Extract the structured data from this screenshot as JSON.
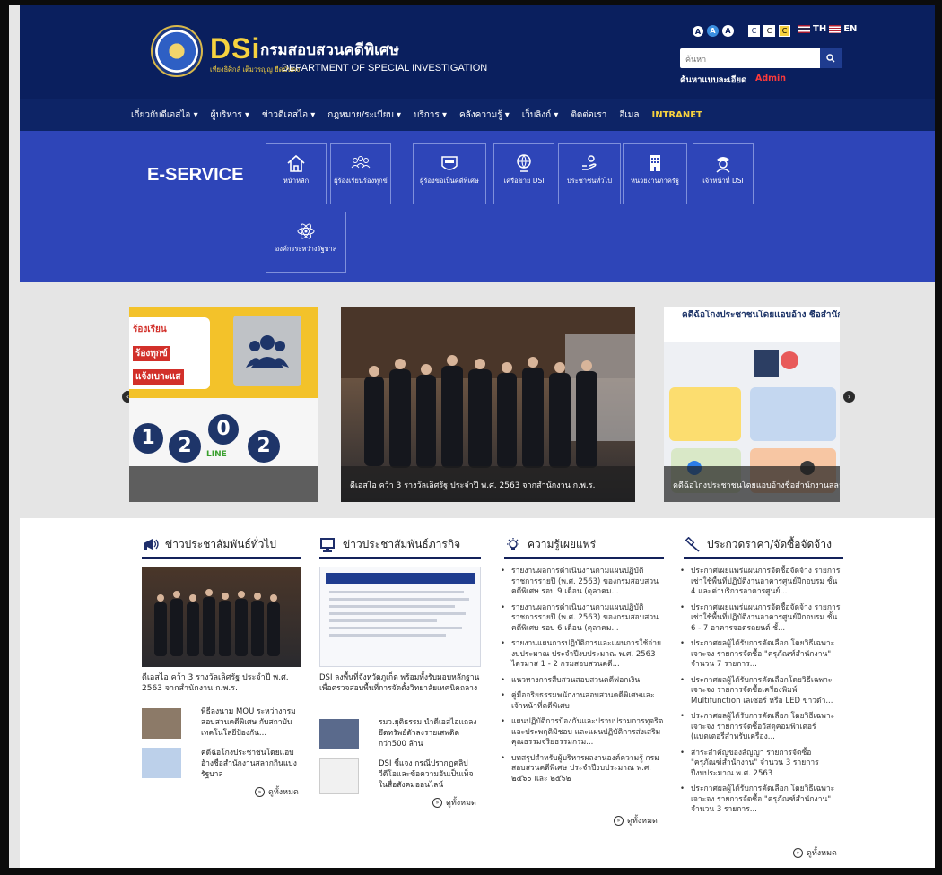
{
  "header": {
    "logo_dsi": "DSi",
    "logo_th": "กรมสอบสวนคดีพิเศษ",
    "logo_sub_th": "เที่ยงธิศิกล์ เต็มวรญญ ยืดมั่นคง",
    "logo_sub_en": "DEPARTMENT OF SPECIAL INVESTIGATION",
    "font_sizes": [
      "A",
      "A",
      "A"
    ],
    "contrast": [
      "C",
      "C",
      "C"
    ],
    "lang_th": "TH",
    "lang_en": "EN",
    "search_placeholder": "ค้นหา",
    "advanced_search": "ค้นหาแบบละเอียด",
    "admin": "Admin"
  },
  "nav": {
    "items": [
      "เกี่ยวกับดีเอสไอ",
      "ผู้บริหาร",
      "ข่าวดีเอสไอ",
      "กฎหมาย/ระเบียบ",
      "บริการ",
      "คลังความรู้",
      "เว็บลิงก์",
      "ติดต่อเรา",
      "อีเมล",
      "INTRANET"
    ]
  },
  "eservice": {
    "title": "E-SERVICE",
    "tiles": [
      "หน้าหลัก",
      "ผู้ร้องเรียนร้องทุกข์",
      "ผู้ร้องขอเป็นคดีพิเศษ",
      "เครือข่าย DSI",
      "ประชาชนทั่วไป",
      "หน่วยงานภาครัฐ",
      "เจ้าหน้าที่ DSI",
      "องค์กรระหว่างรัฐบาล"
    ]
  },
  "slider": {
    "slide1_lines": [
      "ร้องเรียน",
      "ร้องทุกข์",
      "แจ้งเบาะแส"
    ],
    "slide1_number": [
      "1",
      "2",
      "0",
      "2"
    ],
    "slide1_line_tag": "LINE",
    "caption2": "ดีเอสไอ คว้า 3 รางวัลเลิศรัฐ ประจำปี พ.ศ. 2563 จากสำนักงาน ก.พ.ร.",
    "slide3_title": "คดีฉ้อโกงประชาชนโดยแอบอ้าง ชื่อสำนักงานสลากกินแบ่ง",
    "caption3": "คดีฉ้อโกงประชาชนโดยแอบอ้างชื่อสำนักงานสลากกินแบ่งรัฐบาล"
  },
  "news": {
    "col1": {
      "title": "ข่าวประชาสัมพันธ์ทั่วไป",
      "main_caption": "ดีเอสไอ คว้า 3 รางวัลเลิศรัฐ ประจำปี พ.ศ. 2563 จากสำนักงาน ก.พ.ร.",
      "items": [
        "พิธีลงนาม MOU ระหว่างกรมสอบสวนคดีพิเศษ กับสถาบันเทคโนโลยีป้องกัน...",
        "คดีฉ้อโกงประชาชนโดยแอบอ้างชื่อสำนักงานสลากกินแบ่งรัฐบาล"
      ],
      "more": "ดูทั้งหมด"
    },
    "col2": {
      "title": "ข่าวประชาสัมพันธ์ภารกิจ",
      "main_caption": "DSI ลงพื้นที่จังหวัดภูเก็ต พร้อมทั้งรับมอบหลักฐาน เพื่อตรวจสอบพื้นที่การจัดตั้งวิทยาลัยเทคนิคถลาง",
      "items": [
        "รมว.ยุติธรรม นำดีเอสไอแถลงยึดทรัพย์ตัวลงรายเสพติด กว่า500 ล้าน",
        "DSI ชี้แจง กรณีปรากฏคลิปวีดีโอและข้อความอันเป็นเท็จในสื่อสังคมออนไลน์"
      ],
      "more": "ดูทั้งหมด"
    },
    "col3": {
      "title": "ความรู้เผยแพร่",
      "items": [
        "รายงานผลการดำเนินงานตามแผนปฏิบัติราชการรายปี (พ.ศ. 2563) ของกรมสอบสวนคดีพิเศษ รอบ 9 เดือน (ตุลาคม...",
        "รายงานผลการดำเนินงานตามแผนปฏิบัติราชการรายปี (พ.ศ. 2563) ของกรมสอบสวนคดีพิเศษ รอบ 6 เดือน (ตุลาคม...",
        "รายงานแผนการปฏิบัติการและแผนการใช้จ่ายงบประมาณ ประจำปีงบประมาณ พ.ศ. 2563 ไตรมาส 1 - 2 กรมสอบสวนคดี...",
        "แนวทางการสืบสวนสอบสวนคดีฟอกเงิน",
        "คู่มือจริยธรรมพนักงานสอบสวนคดีพิเศษและเจ้าหน้าที่คดีพิเศษ",
        "แผนปฏิบัติการป้องกันและปราบปรามการทุจริตและประพฤติมิชอบ และแผนปฏิบัติการส่งเสริมคุณธรรมจริยธรรมกรม...",
        "บทสรุปสำหรับผู้บริหารผลงานองค์ความรู้ กรมสอบสวนคดีพิเศษ ประจำปีงบประมาณ พ.ศ. ๒๕๖๐ และ ๒๕๖๒"
      ],
      "more": "ดูทั้งหมด"
    },
    "col4": {
      "title": "ประกวดราคา/จัดซื้อจัดจ้าง",
      "items": [
        "ประกาศเผยแพร่แผนการจัดซื้อจัดจ้าง รายการ เช่าใช้พื้นที่ปฏิบัติงานอาคารศูนย์ฝึกอบรม ชั้น 4 และค่าบริการอาคารศูนย์...",
        "ประกาศเผยแพร่แผนการจัดซื้อจัดจ้าง รายการ เช่าใช้พื้นที่ปฏิบัติงานอาคารศูนย์ฝึกอบรม ชั้น 6 - 7 อาคารจอดรถยนต์ ชั้...",
        "ประกาศผลผู้ได้รับการคัดเลือก โดยวิธีเฉพาะเจาะจง รายการจัดซื้อ \"ครุภัณฑ์สำนักงาน\" จำนวน 7 รายการ...",
        "ประกาศผลผู้ได้รับการคัดเลือกโดยวิธีเฉพาะเจาะจง รายการจัดซื้อเครื่องพิมพ์ Multifunction เลเซอร์ หรือ LED ขาวดำ...",
        "ประกาศผลผู้ได้รับการคัดเลือก โดยวิธีเฉพาะเจาะจง รายการจัดซื้อวัสดุคอมพิวเตอร์ (แบตเตอรี่สำหรับเครื่อง...",
        "สาระสำคัญของสัญญา รายการจัดซื้อ \"ครุภัณฑ์สำนักงาน\" จำนวน 3 รายการ ปีงบประมาณ พ.ศ. 2563",
        "ประกาศผลผู้ได้รับการคัดเลือก โดยวิธีเฉพาะเจาะจง รายการจัดซื้อ \"ครุภัณฑ์สำนักงาน\" จำนวน 3 รายการ..."
      ],
      "more": "ดูทั้งหมด"
    }
  },
  "colors": {
    "header_bg": "#0a1f5e",
    "nav_bg": "#0d2466",
    "eservice_bg": "#2e45b8",
    "brand_yellow": "#f7d23f",
    "admin_red": "#ff3a3a"
  }
}
